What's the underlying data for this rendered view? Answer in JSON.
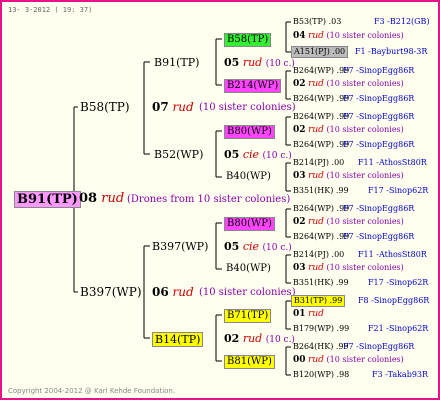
{
  "date": "13- 3-2012 ( 19: 37)",
  "copyright": "Copyright 2004-2012 @ Karl Kehde Foundation.",
  "root": {
    "name": "B91(TP)",
    "gen": "08",
    "race": "rud",
    "note": "(Drones from 10 sister colonies)"
  },
  "l1": {
    "top": {
      "name": "B58(TP)",
      "gen": "07",
      "race": "rud",
      "note": "(10 sister colonies)"
    },
    "bot": {
      "name": "B397(WP)",
      "gen": "06",
      "race": "rud",
      "note": "(10 sister colonies)"
    }
  },
  "l2": {
    "a": {
      "name": "B91(TP)",
      "gen": "05",
      "race": "rud",
      "note": "(10 c.)",
      "top": "B58(TP)",
      "bot": "B214(WP)"
    },
    "b": {
      "name": "B52(WP)",
      "gen": "05",
      "race": "cie",
      "note": "(10 c.)",
      "top": "B80(WP)",
      "bot": "B40(WP)"
    },
    "c": {
      "name": "B397(WP)",
      "gen": "05",
      "race": "cie",
      "note": "(10 c.)",
      "top": "B80(WP)",
      "bot": "B40(WP)"
    },
    "d": {
      "name": "B14(TP)",
      "gen": "02",
      "race": "rud",
      "note": "(10 c.)",
      "top": "B71(TP)",
      "bot": "B81(WP)"
    }
  },
  "l4": [
    {
      "top": "B53(TP) .03",
      "topr": "F3 -B212(GB)",
      "gen": "04",
      "race": "rud",
      "note": "(10 sister colonies)",
      "bot": "A151(PJ) .00",
      "botr": "F1 -Bayburt98-3R"
    },
    {
      "top": "B264(WP) .99",
      "topr": "F7 -SinopEgg86R",
      "gen": "02",
      "race": "rud",
      "note": "(10 sister colonies)",
      "bot": "B264(WP) .99",
      "botr": "F7 -SinopEgg86R"
    },
    {
      "top": "B264(WP) .99",
      "topr": "F7 -SinopEgg86R",
      "gen": "02",
      "race": "rud",
      "note": "(10 sister colonies)",
      "bot": "B264(WP) .99",
      "botr": "F7 -SinopEgg86R"
    },
    {
      "top": "B214(PJ) .00",
      "topr": "F11 -AthosSt80R",
      "gen": "03",
      "race": "rud",
      "note": "(10 sister colonies)",
      "bot": "B351(HK) .99",
      "botr": "F17 -Sinop62R"
    },
    {
      "top": "B264(WP) .99",
      "topr": "F7 -SinopEgg86R",
      "gen": "02",
      "race": "rud",
      "note": "(10 sister colonies)",
      "bot": "B264(WP) .99",
      "botr": "F7 -SinopEgg86R"
    },
    {
      "top": "B214(PJ) .00",
      "topr": "F11 -AthosSt80R",
      "gen": "03",
      "race": "rud",
      "note": "(10 sister colonies)",
      "bot": "B351(HK) .99",
      "botr": "F17 -Sinop62R"
    },
    {
      "top": "B31(TP) .99",
      "topr": "F8 -SinopEgg86R",
      "gen": "01",
      "race": "rud",
      "note": "",
      "bot": "B179(WP) .99",
      "botr": "F21 -Sinop62R"
    },
    {
      "top": "B264(HK) .99",
      "topr": "F7 -SinopEgg86R",
      "gen": "00",
      "race": "rud",
      "note": "(10 sister colonies)",
      "bot": "B120(WP) .98",
      "botr": "F3 -Takab93R"
    }
  ]
}
